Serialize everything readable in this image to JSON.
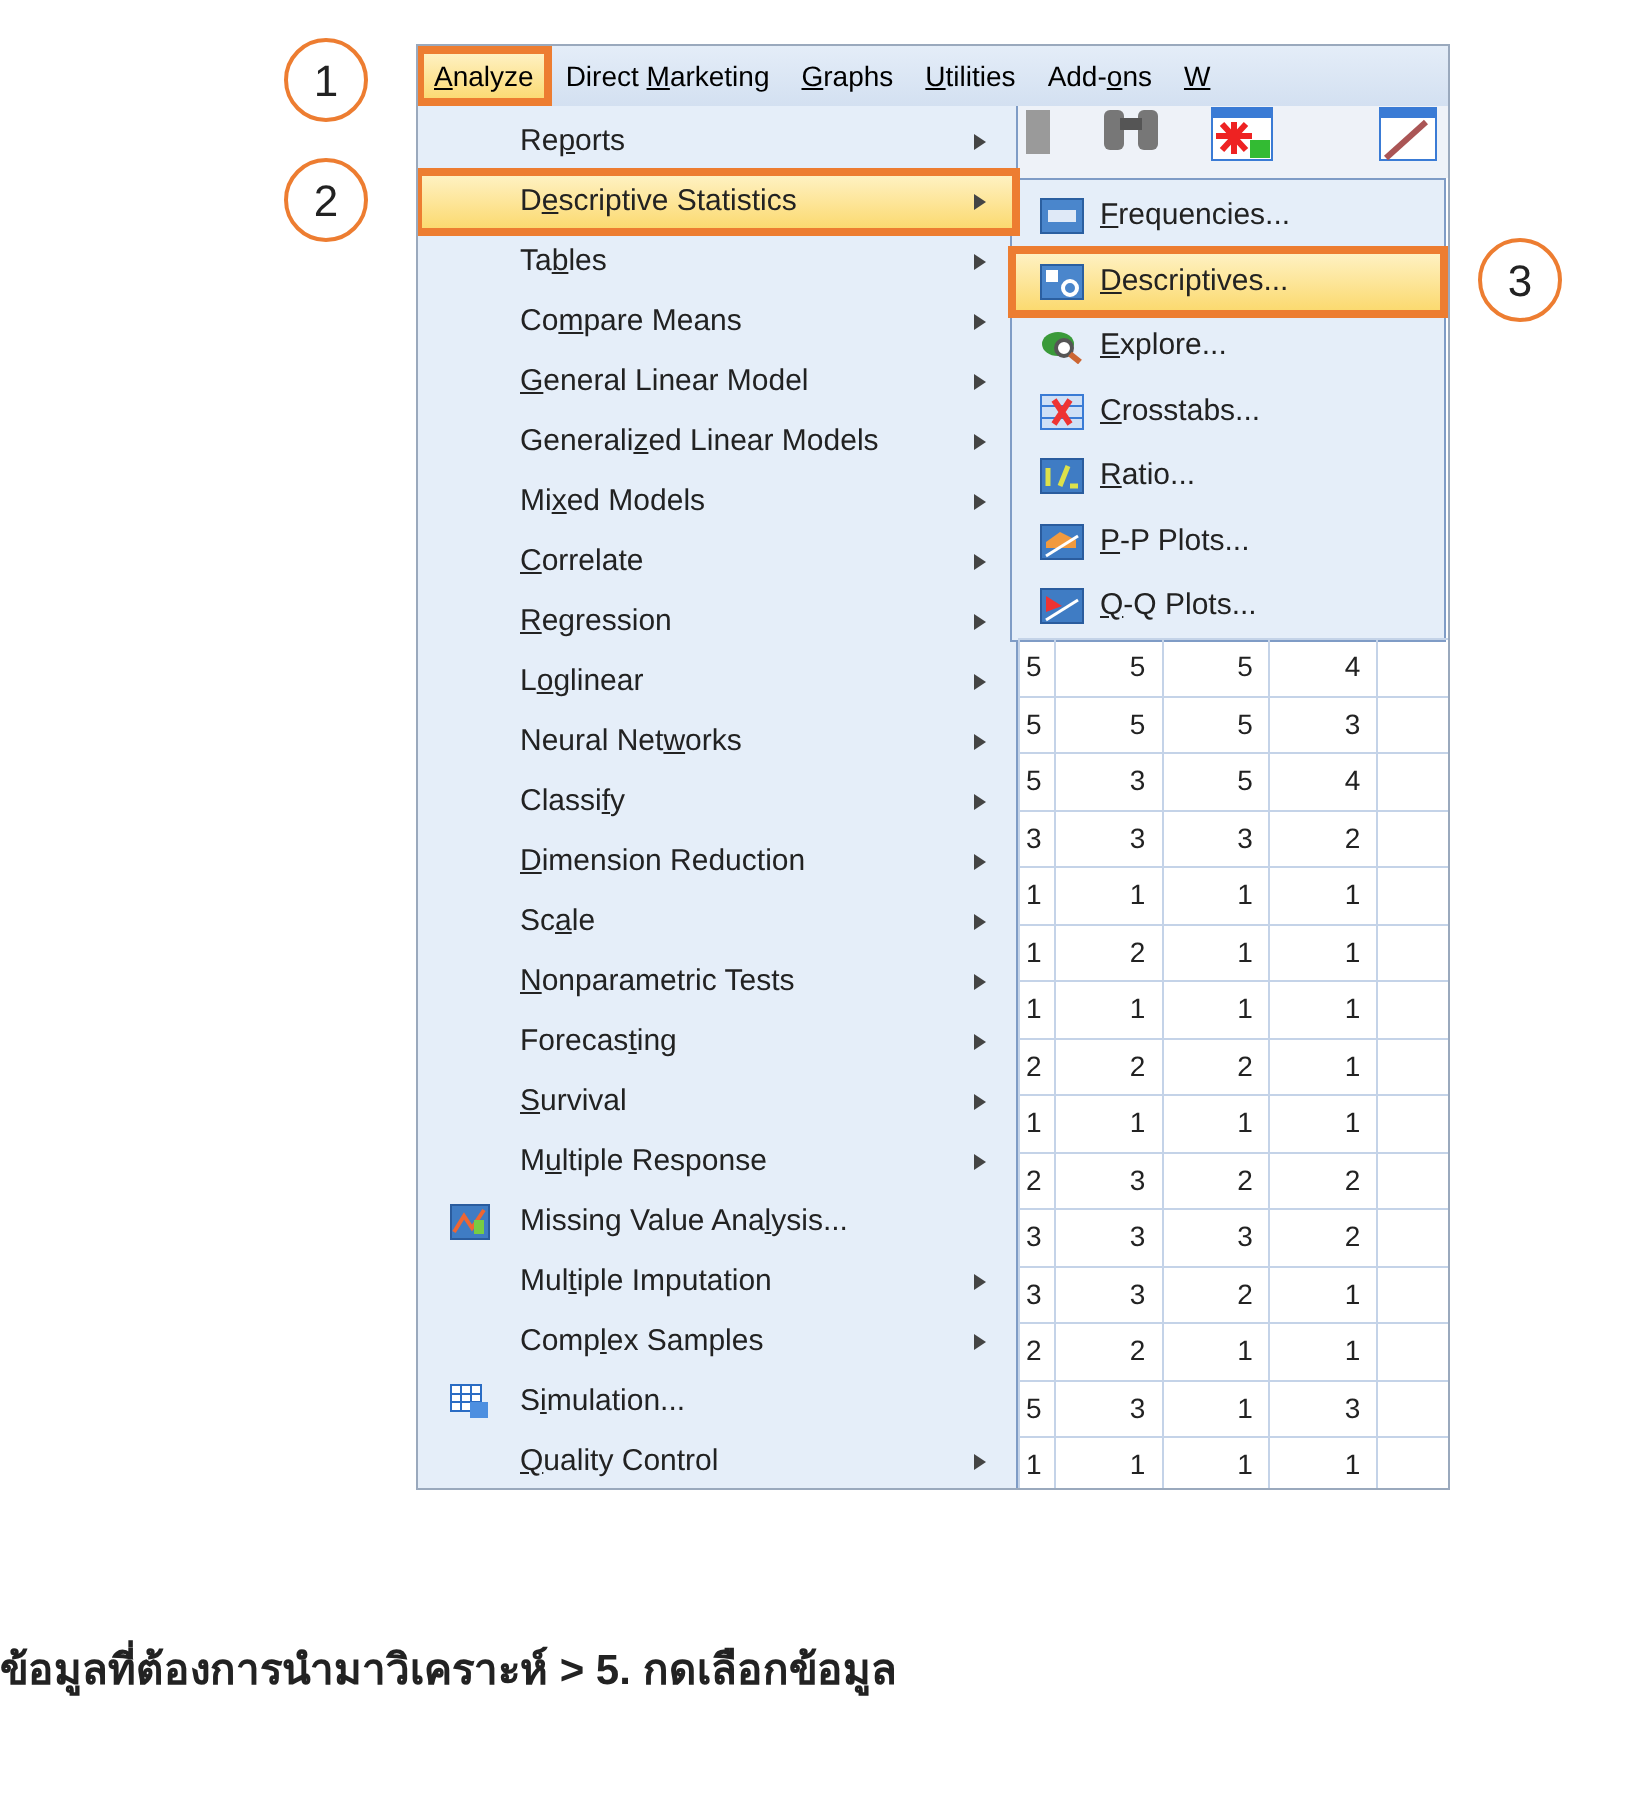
{
  "menu_bar": [
    {
      "key": "A",
      "post": "nalyze",
      "selected": true
    },
    {
      "pre": "Direct ",
      "key": "M",
      "post": "arketing",
      "selected": false
    },
    {
      "key": "G",
      "post": "raphs",
      "selected": false
    },
    {
      "key": "U",
      "post": "tilities",
      "selected": false
    },
    {
      "pre": "Add-",
      "key": "o",
      "post": "ns",
      "selected": false
    },
    {
      "key": "W",
      "selected": false
    }
  ],
  "analyze_menu": [
    {
      "kind": "submenu",
      "pre": "Re",
      "key": "p",
      "post": "orts",
      "selected": false
    },
    {
      "kind": "submenu",
      "pre": "D",
      "key": "e",
      "post": "scriptive Statistics",
      "selected": true
    },
    {
      "kind": "submenu",
      "pre": "Ta",
      "key": "b",
      "post": "les",
      "selected": false
    },
    {
      "kind": "submenu",
      "pre": "Co",
      "key": "m",
      "post": "pare Means",
      "selected": false
    },
    {
      "kind": "submenu",
      "key": "G",
      "post": "eneral Linear Model",
      "selected": false
    },
    {
      "kind": "submenu",
      "pre": "Generali",
      "key": "z",
      "post": "ed Linear Models",
      "selected": false
    },
    {
      "kind": "submenu",
      "pre": "Mi",
      "key": "x",
      "post": "ed Models",
      "selected": false
    },
    {
      "kind": "submenu",
      "key": "C",
      "post": "orrelate",
      "selected": false
    },
    {
      "kind": "submenu",
      "key": "R",
      "post": "egression",
      "selected": false
    },
    {
      "kind": "submenu",
      "pre": "L",
      "key": "o",
      "post": "glinear",
      "selected": false
    },
    {
      "kind": "submenu",
      "pre": "Neural Net",
      "key": "w",
      "post": "orks",
      "selected": false
    },
    {
      "kind": "submenu",
      "pre": "Classi",
      "key": "f",
      "post": "y",
      "selected": false
    },
    {
      "kind": "submenu",
      "key": "D",
      "post": "imension Reduction",
      "selected": false
    },
    {
      "kind": "submenu",
      "pre": "Sc",
      "key": "a",
      "post": "le",
      "selected": false
    },
    {
      "kind": "submenu",
      "key": "N",
      "post": "onparametric Tests",
      "selected": false
    },
    {
      "kind": "submenu",
      "pre": "Forecas",
      "key": "t",
      "post": "ing",
      "selected": false
    },
    {
      "kind": "submenu",
      "key": "S",
      "post": "urvival",
      "selected": false
    },
    {
      "kind": "submenu",
      "pre": "M",
      "key": "u",
      "post": "ltiple Response",
      "selected": false
    },
    {
      "kind": "command",
      "pre": "Missing Value Ana",
      "key": "l",
      "post": "ysis...",
      "selected": false
    },
    {
      "kind": "submenu",
      "pre": "Mul",
      "key": "t",
      "post": "iple Imputation",
      "selected": false
    },
    {
      "kind": "submenu",
      "pre": "Comp",
      "key": "l",
      "post": "ex Samples",
      "selected": false
    },
    {
      "kind": "command",
      "pre": "S",
      "key": "i",
      "post": "mulation...",
      "selected": false
    },
    {
      "kind": "submenu",
      "key": "Q",
      "post": "uality Control",
      "selected": false
    }
  ],
  "descriptive_statistics_submenu": [
    {
      "key": "F",
      "post": "requencies...",
      "selected": false
    },
    {
      "key": "D",
      "post": "escriptives...",
      "selected": true
    },
    {
      "key": "E",
      "post": "xplore...",
      "selected": false
    },
    {
      "key": "C",
      "post": "rosstabs...",
      "selected": false
    },
    {
      "key": "R",
      "post": "atio...",
      "selected": false
    },
    {
      "key": "P",
      "post": "-P Plots...",
      "selected": false
    },
    {
      "key": "Q",
      "post": "-Q Plots...",
      "selected": false
    }
  ],
  "data_grid": {
    "rows": [
      [
        "5",
        "5",
        "5",
        "4"
      ],
      [
        "5",
        "5",
        "5",
        "3"
      ],
      [
        "5",
        "3",
        "5",
        "4"
      ],
      [
        "3",
        "3",
        "3",
        "2"
      ],
      [
        "1",
        "1",
        "1",
        "1"
      ],
      [
        "1",
        "2",
        "1",
        "1"
      ],
      [
        "1",
        "1",
        "1",
        "1"
      ],
      [
        "2",
        "2",
        "2",
        "1"
      ],
      [
        "1",
        "1",
        "1",
        "1"
      ],
      [
        "2",
        "3",
        "2",
        "2"
      ],
      [
        "3",
        "3",
        "3",
        "2"
      ],
      [
        "3",
        "3",
        "2",
        "1"
      ],
      [
        "2",
        "2",
        "1",
        "1"
      ],
      [
        "5",
        "3",
        "1",
        "3"
      ],
      [
        "1",
        "1",
        "1",
        "1"
      ]
    ]
  },
  "step_callouts": [
    "1",
    "2",
    "3"
  ],
  "caption": "ข้อมูลที่ต้องการนำมาวิเคราะห์ > 5. กดเลือกข้อมูล"
}
